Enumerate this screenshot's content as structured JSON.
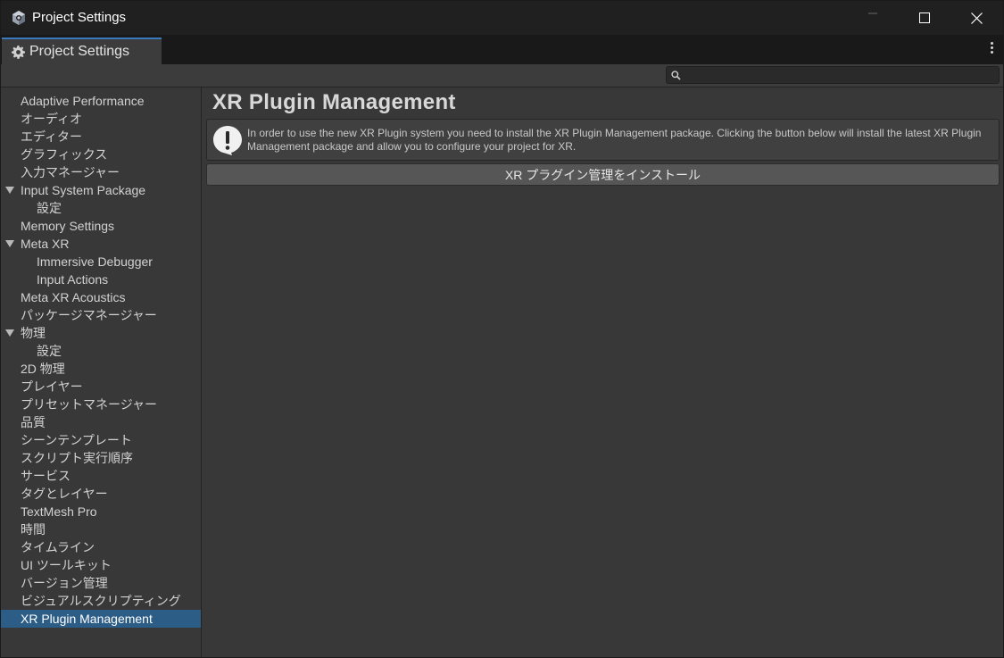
{
  "window": {
    "title": "Project Settings",
    "icon": "unity-cube-icon"
  },
  "tab": {
    "label": "Project Settings",
    "icon": "gear-icon"
  },
  "search": {
    "value": "",
    "placeholder": ""
  },
  "sidebar": {
    "items": [
      {
        "label": "Adaptive Performance"
      },
      {
        "label": "オーディオ"
      },
      {
        "label": "エディター"
      },
      {
        "label": "グラフィックス"
      },
      {
        "label": "入力マネージャー"
      },
      {
        "label": "Input System Package"
      },
      {
        "label": "設定"
      },
      {
        "label": "Memory Settings"
      },
      {
        "label": "Meta XR"
      },
      {
        "label": "Immersive Debugger"
      },
      {
        "label": "Input Actions"
      },
      {
        "label": "Meta XR Acoustics"
      },
      {
        "label": "パッケージマネージャー"
      },
      {
        "label": "物理"
      },
      {
        "label": "設定"
      },
      {
        "label": "2D 物理"
      },
      {
        "label": "プレイヤー"
      },
      {
        "label": "プリセットマネージャー"
      },
      {
        "label": "品質"
      },
      {
        "label": "シーンテンプレート"
      },
      {
        "label": "スクリプト実行順序"
      },
      {
        "label": "サービス"
      },
      {
        "label": "タグとレイヤー"
      },
      {
        "label": "TextMesh Pro"
      },
      {
        "label": "時間"
      },
      {
        "label": "タイムライン"
      },
      {
        "label": "UI ツールキット"
      },
      {
        "label": "バージョン管理"
      },
      {
        "label": "ビジュアルスクリプティング"
      },
      {
        "label": "XR Plugin Management"
      }
    ],
    "selected": "XR Plugin Management"
  },
  "main": {
    "title": "XR Plugin Management",
    "help_message": "In order to use the new XR Plugin system you need to install the XR Plugin Management package. Clicking the button below will install the latest XR Plugin Management package and allow you to configure your project for XR.",
    "help_icon": "warning-icon",
    "install_button": "XR プラグイン管理をインストール"
  },
  "colors": {
    "background": "#383838",
    "selection": "#2c5d87",
    "tab_accent": "#3a79bb",
    "titlebar": "#202020"
  }
}
